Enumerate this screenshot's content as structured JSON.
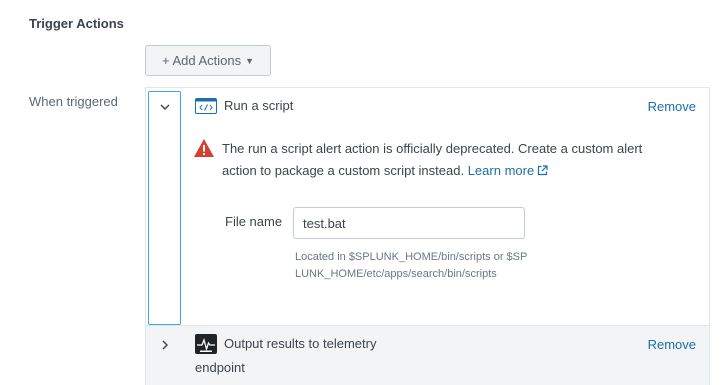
{
  "section": {
    "title": "Trigger Actions"
  },
  "add_actions": {
    "label": "+ Add Actions"
  },
  "when_triggered": {
    "label": "When triggered"
  },
  "actions": [
    {
      "title": "Run a script",
      "remove_label": "Remove",
      "expanded": true,
      "warning_text": "The run a script alert action is officially deprecated. Create a custom alert action to package a custom script instead.",
      "learn_more": "Learn more",
      "file_name_label": "File name",
      "file_name_value": "test.bat",
      "file_help": "Located in $SPLUNK_HOME/bin/scripts or $SPLUNK_HOME/etc/apps/search/bin/scripts"
    },
    {
      "title_line1": "Output results to telemetry",
      "title_line2": "endpoint",
      "remove_label": "Remove",
      "expanded": false
    }
  ],
  "colors": {
    "link": "#1a6fa6",
    "focus_border": "#3da9e0",
    "warning": "#d6402f"
  }
}
